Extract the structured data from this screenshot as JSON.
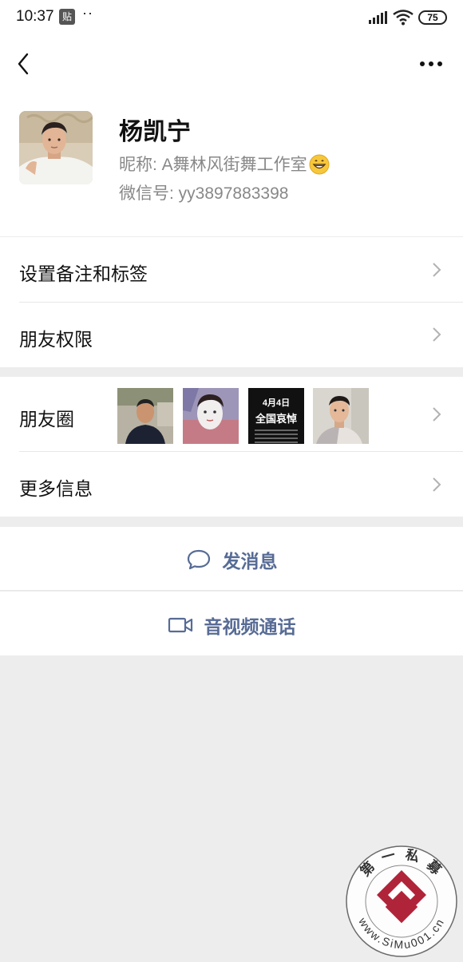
{
  "status_bar": {
    "time": "10:37",
    "paste_badge": "贴",
    "dots": "··",
    "battery": "75"
  },
  "profile": {
    "name": "杨凯宁",
    "nickname": "昵称:  A舞林风街舞工作室",
    "nickname_emoji": "grinning-face-emoji",
    "wechat_id": "微信号:  yy3897883398"
  },
  "menu": {
    "set_remark": "设置备注和标签",
    "friend_permissions": "朋友权限",
    "moments": "朋友圈",
    "more_info": "更多信息"
  },
  "moments_thumbs": {
    "news_date": "4月4日",
    "news_title": "全国哀悼"
  },
  "actions": {
    "send_message": "发消息",
    "video_call": "音视频通话"
  },
  "watermark": {
    "top_text": "第 一 私 募",
    "bottom_text": "www.SiMu001.cn"
  },
  "colors": {
    "link_blue": "#576b95",
    "page_bg": "#ededed",
    "watermark_red": "#b0243a"
  }
}
